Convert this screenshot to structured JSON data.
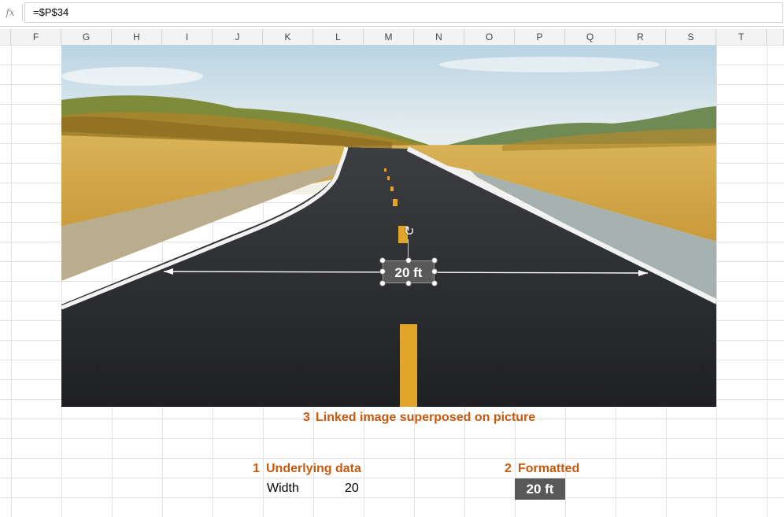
{
  "formula_bar": {
    "fx_label": "fx",
    "formula": "=$P$34"
  },
  "columns": [
    "F",
    "G",
    "H",
    "I",
    "J",
    "K",
    "L",
    "M",
    "N",
    "O",
    "P",
    "Q",
    "R",
    "S",
    "T"
  ],
  "picture": {
    "description_hidden": true
  },
  "linked_image": {
    "text": "20 ft"
  },
  "captions": {
    "linked_number": "3",
    "linked_label": "Linked image superposed on picture",
    "underlying_number": "1",
    "underlying_label": "Underlying data",
    "formatted_number": "2",
    "formatted_label": "Formatted"
  },
  "cells": {
    "width_label": "Width",
    "width_value": "20",
    "formatted_value": "20 ft"
  },
  "colors": {
    "caption": "#c55a11",
    "formatted_fill": "#595959"
  }
}
